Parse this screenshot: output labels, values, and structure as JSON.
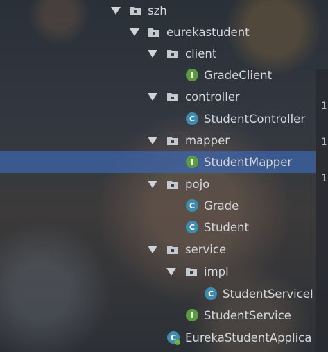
{
  "tree": {
    "nodes": [
      {
        "label": "szh",
        "kind": "package",
        "expanded": true
      },
      {
        "label": "eurekastudent",
        "kind": "package",
        "expanded": true
      },
      {
        "label": "client",
        "kind": "package",
        "expanded": true
      },
      {
        "label": "GradeClient",
        "kind": "interface",
        "badge": "I"
      },
      {
        "label": "controller",
        "kind": "package",
        "expanded": true
      },
      {
        "label": "StudentController",
        "kind": "class",
        "badge": "C"
      },
      {
        "label": "mapper",
        "kind": "package",
        "expanded": true
      },
      {
        "label": "StudentMapper",
        "kind": "interface",
        "badge": "I",
        "selected": true
      },
      {
        "label": "pojo",
        "kind": "package",
        "expanded": true
      },
      {
        "label": "Grade",
        "kind": "class",
        "badge": "C"
      },
      {
        "label": "Student",
        "kind": "class",
        "badge": "C"
      },
      {
        "label": "service",
        "kind": "package",
        "expanded": true
      },
      {
        "label": "impl",
        "kind": "package",
        "expanded": true
      },
      {
        "label": "StudentServiceI",
        "kind": "class",
        "badge": "C"
      },
      {
        "label": "StudentService",
        "kind": "interface",
        "badge": "I"
      },
      {
        "label": "EurekaStudentApplica",
        "kind": "application",
        "badge": "C"
      }
    ]
  },
  "gutter": {
    "numbers": [
      "1",
      "1",
      "1"
    ]
  },
  "colors": {
    "selection": "#3c64aa",
    "interface_badge": "#5b9b42",
    "class_badge": "#3f8cae",
    "text": "#d4d8dd"
  }
}
